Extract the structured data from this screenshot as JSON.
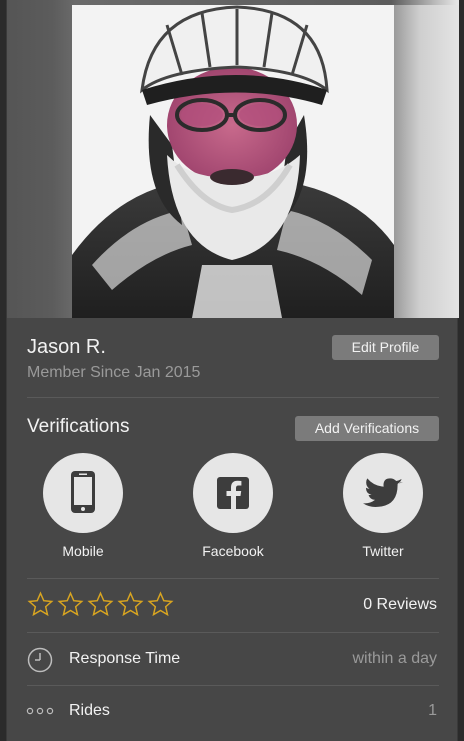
{
  "profile": {
    "name": "Jason R.",
    "member_since": "Member Since Jan 2015",
    "edit_label": "Edit Profile",
    "photo_icon": "profile-photo"
  },
  "verifications": {
    "title": "Verifications",
    "add_label": "Add Verifications",
    "items": [
      {
        "label": "Mobile",
        "icon": "mobile-icon"
      },
      {
        "label": "Facebook",
        "icon": "facebook-icon"
      },
      {
        "label": "Twitter",
        "icon": "twitter-icon"
      }
    ]
  },
  "rating": {
    "stars_filled": 0,
    "stars_total": 5,
    "star_color": "#d9a520",
    "reviews_label": "0 Reviews"
  },
  "stats": {
    "response_time_label": "Response Time",
    "response_time_value": "within a day",
    "rides_label": "Rides",
    "rides_value": "1"
  },
  "colors": {
    "card_bg": "#474747",
    "button_bg": "#7b7b7b",
    "icon_circle": "#e6e6e6",
    "icon_glyph": "#3d3d3d"
  }
}
